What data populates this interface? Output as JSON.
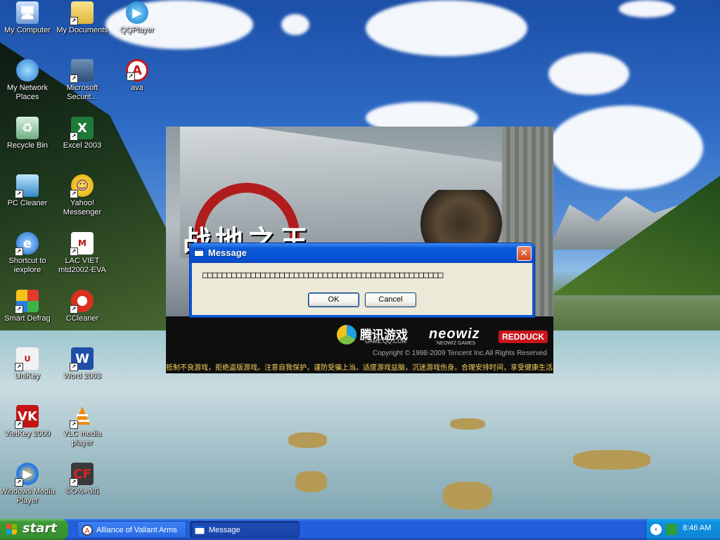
{
  "desktop": {
    "icons": [
      {
        "label": "My Computer",
        "icon": "computer-icon"
      },
      {
        "label": "My Documents",
        "icon": "documents-folder-icon"
      },
      {
        "label": "QQPlayer",
        "icon": "qqplayer-icon"
      },
      {
        "label": "My Network Places",
        "icon": "network-places-icon"
      },
      {
        "label": "Microsoft Securit...",
        "icon": "security-icon"
      },
      {
        "label": "ava",
        "icon": "ava-game-icon"
      },
      {
        "label": "Recycle Bin",
        "icon": "recycle-bin-icon"
      },
      {
        "label": "Excel 2003",
        "icon": "excel-icon"
      },
      {
        "label": "PC Cleaner",
        "icon": "pc-cleaner-icon"
      },
      {
        "label": "Yahoo! Messenger",
        "icon": "yahoo-messenger-icon"
      },
      {
        "label": "Shortcut to iexplore",
        "icon": "internet-explorer-icon"
      },
      {
        "label": "LAC VIET mtd2002-EVA",
        "icon": "dictionary-icon"
      },
      {
        "label": "Smart Defrag",
        "icon": "defrag-icon"
      },
      {
        "label": "CCleaner",
        "icon": "ccleaner-icon"
      },
      {
        "label": "UniKey",
        "icon": "unikey-icon"
      },
      {
        "label": "Word 2003",
        "icon": "word-icon"
      },
      {
        "label": "VietKey 2000",
        "icon": "vietkey-icon"
      },
      {
        "label": "VLC media player",
        "icon": "vlc-icon"
      },
      {
        "label": "Windows Media Player",
        "icon": "media-player-icon"
      },
      {
        "label": "©Ò½»ðíß",
        "icon": "crossfire-icon"
      }
    ]
  },
  "launcher": {
    "title": "战地之王",
    "brand_tencent": "腾讯游戏",
    "brand_tencent_sub": "GAME.QQ.COM",
    "brand_neowiz": "neowiz",
    "brand_neowiz_sub": "NEOWIZ GAMES",
    "brand_redduck": "REDDUCK",
    "copyright": "Copyright © 1998-2009 Tencent Inc.All Rights Reserved",
    "notice": "抵制不良游戏，拒绝盗版游戏。注意自我保护，谨防受骗上当。适度游戏益脑，沉迷游戏伤身。合理安排时间，享受健康生活。"
  },
  "dialog": {
    "title": "Message",
    "message": "□□□□□□□□□□□□□□□□□□□□□□□□□□□□□□□□□□□□□□□□□□□□□□□□□□",
    "ok_label": "OK",
    "cancel_label": "Cancel",
    "close_glyph": "✕"
  },
  "taskbar": {
    "start_label": "start",
    "tasks": [
      {
        "label": "Alliance of Valiant Arms",
        "icon": "ava-game-icon"
      },
      {
        "label": "Message",
        "icon": "window-icon"
      }
    ],
    "tray_chevron": "‹",
    "clock": "8:46 AM"
  },
  "colors": {
    "titlebar_blue": "#0a5ad9",
    "start_green": "#3c9a36",
    "close_red": "#d0451c",
    "dialog_face": "#ece9d8"
  }
}
